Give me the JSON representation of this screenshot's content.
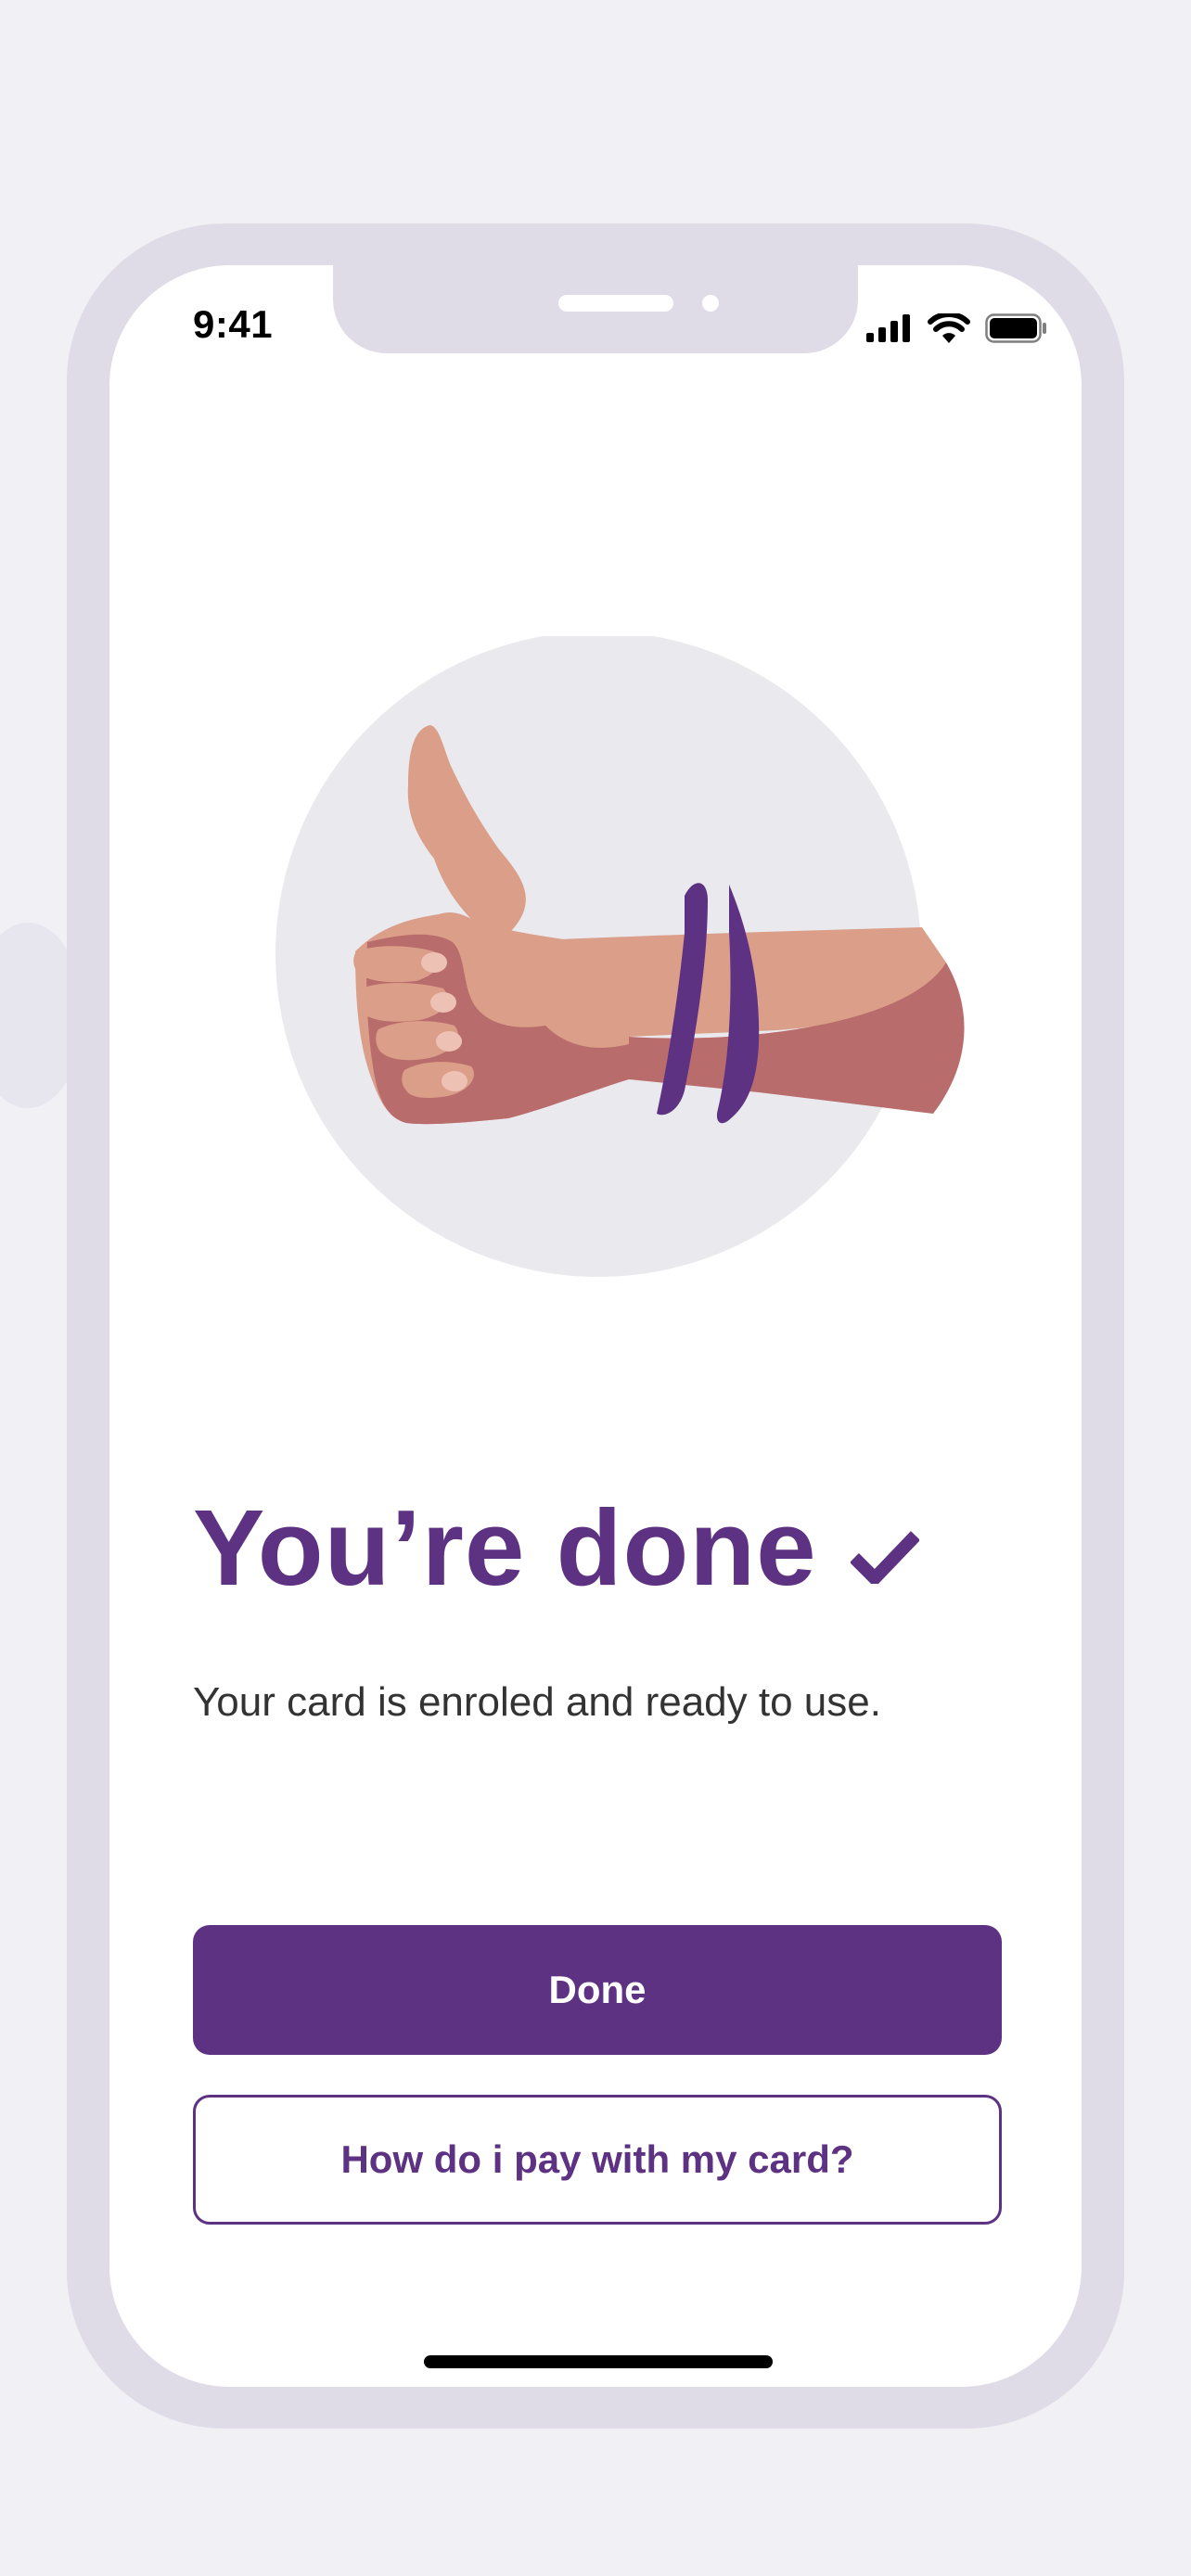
{
  "status_bar": {
    "time": "9:41",
    "icons": [
      "signal-icon",
      "wifi-icon",
      "battery-icon"
    ]
  },
  "illustration": {
    "name": "thumbs-up-illustration"
  },
  "content": {
    "title": "You’re done",
    "title_icon": "checkmark-icon",
    "subtitle": "Your card is enroled and ready to use."
  },
  "actions": {
    "primary_label": "Done",
    "secondary_label": "How do i pay with my card?"
  },
  "colors": {
    "brand": "#5E3283",
    "background": "#F1F0F5",
    "frame": "#DFDCE7",
    "skin": "#DB9E89",
    "skin_shadow": "#B96C6C"
  }
}
